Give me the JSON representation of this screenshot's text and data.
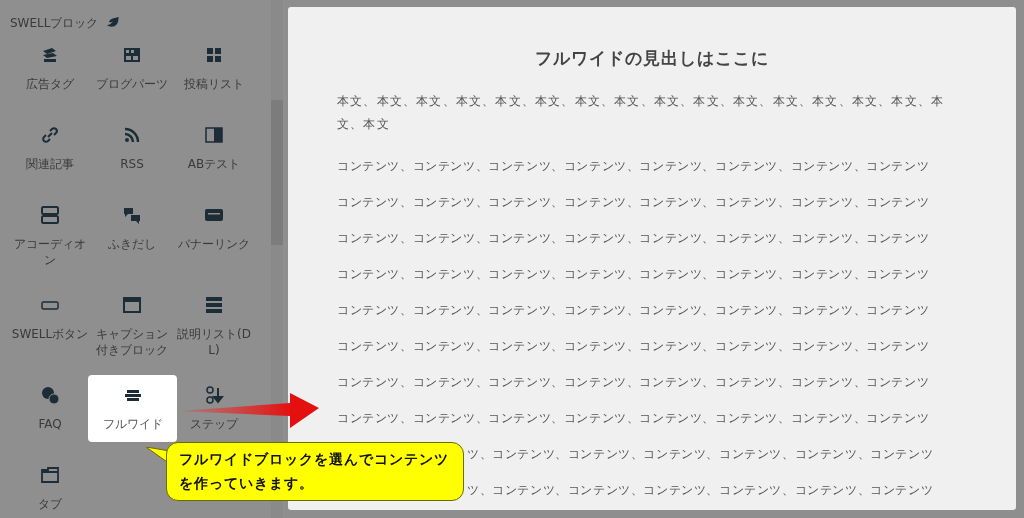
{
  "sidebar": {
    "section_title": "SWELLブロック",
    "items": [
      {
        "label": "広告タグ",
        "selected": false
      },
      {
        "label": "ブログパーツ",
        "selected": false
      },
      {
        "label": "投稿リスト",
        "selected": false
      },
      {
        "label": "関連記事",
        "selected": false
      },
      {
        "label": "RSS",
        "selected": false
      },
      {
        "label": "ABテスト",
        "selected": false
      },
      {
        "label": "アコーディオン",
        "selected": false
      },
      {
        "label": "ふきだし",
        "selected": false
      },
      {
        "label": "バナーリンク",
        "selected": false
      },
      {
        "label": "SWELLボタン",
        "selected": false
      },
      {
        "label": "キャプション付きブロック",
        "selected": false
      },
      {
        "label": "説明リスト(DL)",
        "selected": false
      },
      {
        "label": "FAQ",
        "selected": false
      },
      {
        "label": "フルワイド",
        "selected": true
      },
      {
        "label": "ステップ",
        "selected": false
      },
      {
        "label": "タブ",
        "selected": false
      }
    ]
  },
  "preview": {
    "heading": "フルワイドの見出しはここに",
    "body": "本文、本文、本文、本文、本文、本文、本文、本文、本文、本文、本文、本文、本文、本文、本文、本文、本文",
    "rows": [
      {
        "kind": "full",
        "text": "コンテンツ、コンテンツ、コンテンツ、コンテンツ、コンテンツ、コンテンツ、コンテンツ、コンテンツ"
      },
      {
        "kind": "full",
        "text": "コンテンツ、コンテンツ、コンテンツ、コンテンツ、コンテンツ、コンテンツ、コンテンツ、コンテンツ"
      },
      {
        "kind": "full",
        "text": "コンテンツ、コンテンツ、コンテンツ、コンテンツ、コンテンツ、コンテンツ、コンテンツ、コンテンツ"
      },
      {
        "kind": "full",
        "text": "コンテンツ、コンテンツ、コンテンツ、コンテンツ、コンテンツ、コンテンツ、コンテンツ、コンテンツ"
      },
      {
        "kind": "full",
        "text": "コンテンツ、コンテンツ、コンテンツ、コンテンツ、コンテンツ、コンテンツ、コンテンツ、コンテンツ"
      },
      {
        "kind": "full",
        "text": "コンテンツ、コンテンツ、コンテンツ、コンテンツ、コンテンツ、コンテンツ、コンテンツ、コンテンツ"
      },
      {
        "kind": "full",
        "text": "コンテンツ、コンテンツ、コンテンツ、コンテンツ、コンテンツ、コンテンツ、コンテンツ、コンテンツ"
      },
      {
        "kind": "full",
        "text": "コンテンツ、コンテンツ、コンテンツ、コンテンツ、コンテンツ、コンテンツ、コンテンツ、コンテンツ"
      },
      {
        "kind": "partial",
        "text": "ツ、コンテンツ、コンテンツ、コンテンツ、コンテンツ、コンテンツ、コンテンツ"
      },
      {
        "kind": "partial",
        "text": "ツ、コンテンツ、コンテンツ、コンテンツ、コンテンツ、コンテンツ、コンテンツ"
      }
    ]
  },
  "callout": {
    "lines": [
      "フルワイドブロックを選んでコンテンツ",
      "を作っていきます。"
    ]
  }
}
